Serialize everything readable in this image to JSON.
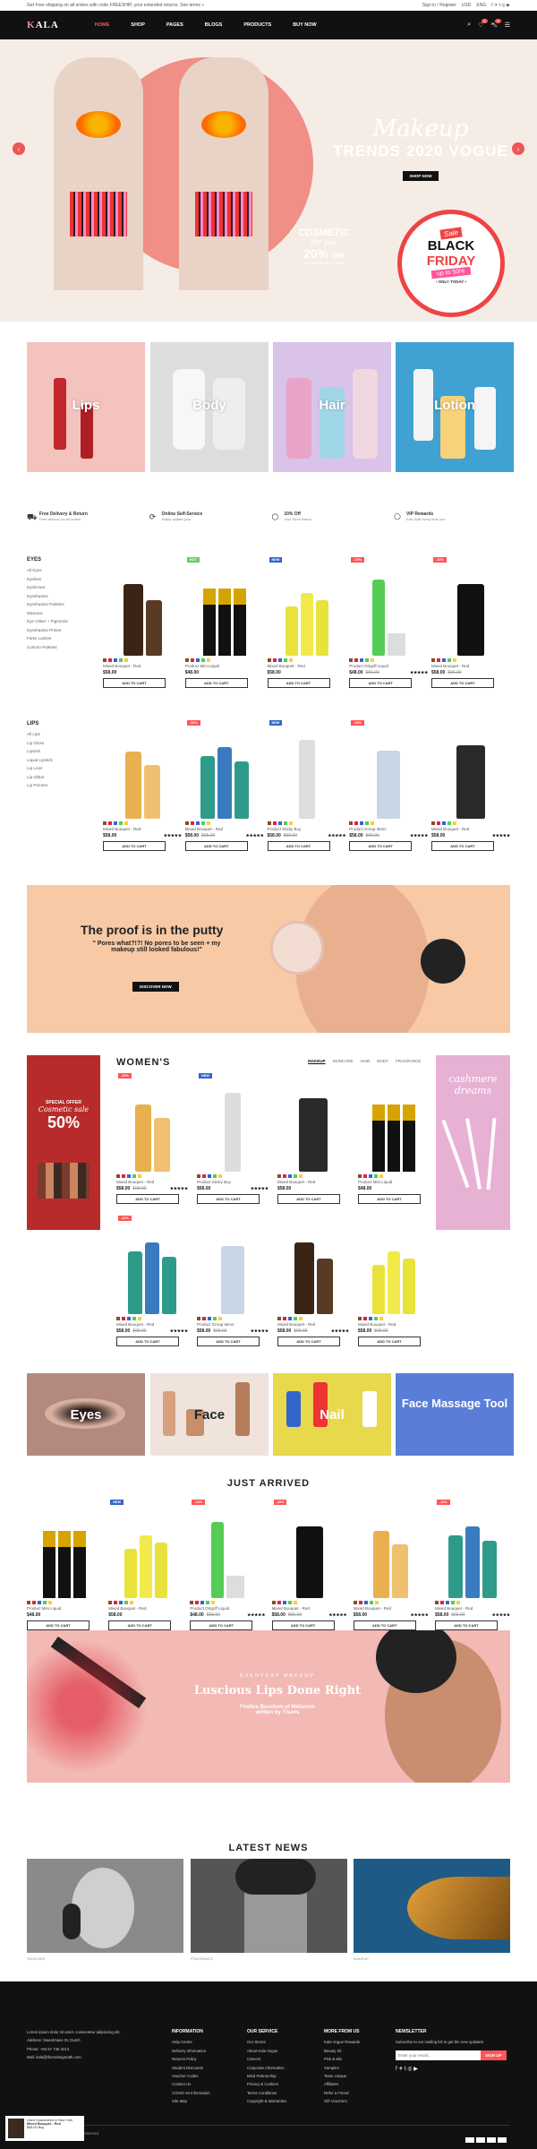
{
  "topbar": {
    "promo": "Get Free shipping on all orders with code FREESHIP, your extended returns. See terms »",
    "links": [
      "Sign in / Register",
      "USD",
      "ENG"
    ]
  },
  "brand": {
    "logo_a": "K",
    "logo_b": "ALA",
    "tagline": "BEAUTY"
  },
  "nav": [
    "HOME",
    "SHOP",
    "PAGES",
    "BLOGS",
    "PRODUCTS",
    "BUY NOW"
  ],
  "header_counts": {
    "wishlist": "0",
    "cart": "0"
  },
  "hero": {
    "script": "Makeup",
    "title": "TRENDS 2020 VOGUE",
    "button": "SHOP NOW",
    "cosmetic": {
      "l1": "COSMETIC",
      "l2": "for you",
      "l3": "20%",
      "l4": "OFF",
      "l5": "FOR ALL HOUSE BRAND"
    },
    "sale": {
      "s1": "Sale",
      "s2": "BLACK",
      "s3": "FRIDAY",
      "s4": "up to 50%",
      "s5": "• ONLY TODAY •"
    }
  },
  "categories": [
    "Lips",
    "Body",
    "Hair",
    "Lotion"
  ],
  "services": [
    {
      "t": "Free Delivery & Return",
      "s": "Free delivery on all orders"
    },
    {
      "t": "Online Self-Service",
      "s": "Easily update your"
    },
    {
      "t": "10% Off",
      "s": "Your Store Brand"
    },
    {
      "t": "VIP Rewards",
      "s": "Earn $48 every time you"
    }
  ],
  "eyes": {
    "title": "EYES",
    "items": [
      "All Eyes",
      "Eyeliner",
      "Eyebrows",
      "Eyeshadow",
      "Eyeshadow Palettes",
      "Mascara",
      "Eye Glitter + Pigments",
      "Eyeshadow Primer",
      "False Lashes",
      "Custom Palettes"
    ]
  },
  "lips_menu": {
    "title": "LIPS",
    "items": [
      "All Lips",
      "Lip Gloss",
      "Lipstick",
      "Liquid Lipstick",
      "Lip Liner",
      "Lip Glitter",
      "Lip Primers"
    ]
  },
  "row1": [
    {
      "tag": "",
      "tagc": "",
      "name": "Mixed Bouquet - Red",
      "price": "$58.00",
      "old": "",
      "stars": ""
    },
    {
      "tag": "HOT",
      "tagc": "#6c6",
      "name": "Product Mini Liquid",
      "price": "$48.00",
      "old": "",
      "stars": ""
    },
    {
      "tag": "NEW",
      "tagc": "#36c",
      "name": "Mixed Bouquet - Red",
      "price": "$58.00",
      "old": "",
      "stars": ""
    },
    {
      "tag": "-10%",
      "tagc": "#f55",
      "name": "Product Ortgoff Liquid",
      "price": "$48.00",
      "old": "$55.00",
      "stars": "★★★★★"
    },
    {
      "tag": "-10%",
      "tagc": "#f55",
      "name": "Mixed Bouquet - Red",
      "price": "$58.00",
      "old": "$65.00",
      "stars": ""
    }
  ],
  "row2": [
    {
      "tag": "",
      "tagc": "",
      "name": "Mixed Bouquet - Red",
      "price": "$58.00",
      "old": "",
      "stars": "★★★★★"
    },
    {
      "tag": "-10%",
      "tagc": "#f55",
      "name": "Mixed Bouquet - Red",
      "price": "$58.00",
      "old": "$65.00",
      "stars": "★★★★★"
    },
    {
      "tag": "NEW",
      "tagc": "#36c",
      "name": "Product Sticky Buy",
      "price": "$58.00",
      "old": "$65.00",
      "stars": "★★★★★"
    },
    {
      "tag": "-10%",
      "tagc": "#f55",
      "name": "Product Group items",
      "price": "$58.00",
      "old": "$65.00",
      "stars": "★★★★★"
    },
    {
      "tag": "",
      "tagc": "",
      "name": "Mixed Bouquet - Red",
      "price": "$58.00",
      "old": "",
      "stars": "★★★★★"
    }
  ],
  "add_to_cart": "ADD TO CART",
  "putty": {
    "title": "The proof is in the putty",
    "text": "\" Pores what?!?! No pores to be seen + my makeup still looked fabulous!\"",
    "button": "DISCOVER NOW"
  },
  "women": {
    "title": "WOMEN'S",
    "tabs": [
      "MAKEUP",
      "SKINCARE",
      "HAIR",
      "BODY",
      "FRAGRANCE"
    ],
    "offer": {
      "a": "SPECIAL OFFER",
      "b": "Cosmetic sale",
      "c": "50%"
    },
    "promo": "cashmere dreams"
  },
  "wrow1": [
    {
      "tag": "-10%",
      "tagc": "#f55",
      "name": "Mixed Bouquet - Red",
      "price": "$58.00",
      "old": "$65.00",
      "stars": "★★★★★"
    },
    {
      "tag": "NEW",
      "tagc": "#36c",
      "name": "Product Sticky Buy",
      "price": "$58.00",
      "old": "",
      "stars": "★★★★★"
    },
    {
      "tag": "",
      "tagc": "",
      "name": "Mixed Bouquet - Red",
      "price": "$58.00",
      "old": "",
      "stars": ""
    },
    {
      "tag": "",
      "tagc": "",
      "name": "Product Mini Liquid",
      "price": "$48.00",
      "old": "",
      "stars": ""
    }
  ],
  "wrow2": [
    {
      "tag": "-10%",
      "tagc": "#f55",
      "name": "Mixed Bouquet - Red",
      "price": "$58.00",
      "old": "$65.00",
      "stars": "★★★★★"
    },
    {
      "tag": "",
      "tagc": "",
      "name": "Product Group items",
      "price": "$58.00",
      "old": "$65.00",
      "stars": "★★★★★"
    },
    {
      "tag": "",
      "tagc": "",
      "name": "Mixed Bouquet - Red",
      "price": "$58.00",
      "old": "$65.00",
      "stars": "★★★★★"
    },
    {
      "tag": "",
      "tagc": "",
      "name": "Mixed Bouquet - Red",
      "price": "$58.00",
      "old": "$65.00",
      "stars": ""
    }
  ],
  "categories2": [
    "Eyes",
    "Face",
    "Nail",
    "Face Massage Tool"
  ],
  "arrived": {
    "title": "JUST ARRIVED",
    "items": [
      {
        "tag": "",
        "tagc": "",
        "name": "Product Mini Liquid",
        "price": "$48.00",
        "old": "",
        "stars": ""
      },
      {
        "tag": "NEW",
        "tagc": "#36c",
        "name": "Mixed Bouquet - Red",
        "price": "$58.00",
        "old": "",
        "stars": ""
      },
      {
        "tag": "-10%",
        "tagc": "#f55",
        "name": "Product Ortgoff Liquid",
        "price": "$48.00",
        "old": "$55.00",
        "stars": "★★★★★"
      },
      {
        "tag": "-10%",
        "tagc": "#f55",
        "name": "Mixed Bouquet - Red",
        "price": "$58.00",
        "old": "$65.00",
        "stars": "★★★★★"
      },
      {
        "tag": "",
        "tagc": "",
        "name": "Mixed Bouquet - Red",
        "price": "$58.00",
        "old": "",
        "stars": "★★★★★"
      },
      {
        "tag": "-10%",
        "tagc": "#f55",
        "name": "Mixed Bouquet - Red",
        "price": "$58.00",
        "old": "$65.00",
        "stars": "★★★★★"
      }
    ]
  },
  "lips_banner": {
    "a": "EVERYDAY MAKEUP",
    "b": "Luscious Lips Done Right",
    "c": "Findice Boonium of Metanum",
    "d": "written by Tisans"
  },
  "news": {
    "title": "LATEST NEWS",
    "items": [
      {
        "cat": "SKINCARE",
        "t": "LISTEN TO DIRTY PROJECTORS' COVER OF RAINBOW'S REMIX",
        "p": "Lorem ipsum dolor sit amet, consectetur adipiscing elit. Suspendisse in lectus scelerisque lectus suscipit...",
        "m": "READ MORE »"
      },
      {
        "cat": "FRAGRANCE",
        "t": "LOVE SONGS: RIHANNA'S FIFTY-TWO SINGLES, RANKED",
        "p": "Lorem ipsum dolor sit amet, consectetur adipiscing elit. Suspendisse in lectus scelerisque lectus suscipit...",
        "m": "READ MORE »"
      },
      {
        "cat": "MAKEUP",
        "t": "THE SUNDAY REVIEW: STREAMING LIVE WITH STEVE",
        "p": "Lorem ipsum dolor sit amet, consectetur adipiscing elit. Suspendisse in lectus scelerisque lectus suscipit...",
        "m": "READ MORE »"
      }
    ]
  },
  "footer": {
    "about": "Lorem ipsum dolor sit amet, consectetur adipiscing elit.",
    "address": "Address: Sweetmase St, Dutch",
    "phone": "Phone: +84 67 735 3413",
    "email": "Mail: kala@themebegreath.com",
    "cols": [
      {
        "h": "INFORMATION",
        "i": [
          "Help Centre",
          "Delivery Information",
          "Returns Policy",
          "Student Discounts",
          "Voucher Codes",
          "Contact Us",
          "COVID-19 Information",
          "Site Map"
        ]
      },
      {
        "h": "OUR SERVICE",
        "i": [
          "Our Stores",
          "About Kala Vogue",
          "Careers",
          "Corporate Information",
          "Mind Partnership",
          "Privacy & Cookies",
          "Terms Conditions",
          "Copyright & Warranties"
        ]
      },
      {
        "h": "MORE FROM US",
        "i": [
          "Kala Vogue Rewards",
          "Beauty Kit",
          "Pick & Mix",
          "Samples",
          "Team Unique",
          "Affiliates",
          "Refer a Friend",
          "Gift Vouchers"
        ]
      }
    ],
    "newsletter": {
      "h": "NEWSLETTER",
      "t": "Subscribe to our mailing list to get the new updates!",
      "ph": "Enter your email...",
      "btn": "SIGN UP"
    },
    "copy": "Copyright © 2020 Kala. All rights reserved.",
    "popup": {
      "a": "Used Guaranteed in New York",
      "b": "Mixed Bouquet - Red",
      "c": "$58.00 Buy"
    }
  },
  "colors": {
    "accent": "#f55",
    "dark": "#111",
    "hero": "#f6ece6"
  }
}
